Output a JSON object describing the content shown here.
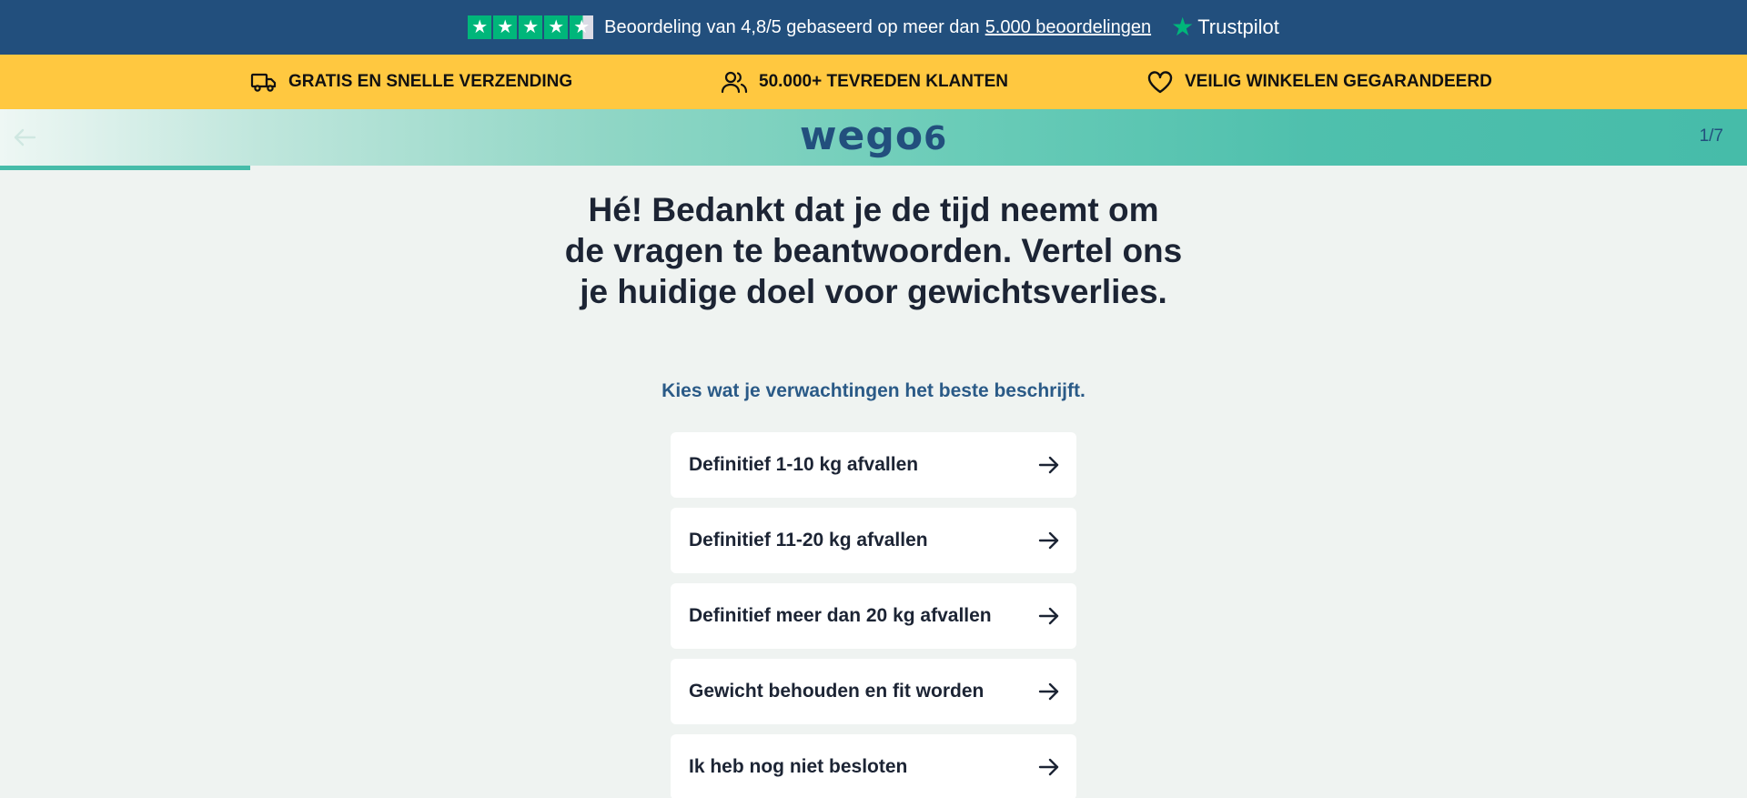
{
  "trustbar": {
    "rating_text": "Beoordeling van 4,8/5 gebaseerd op meer dan",
    "reviews_link": "5.000 beoordelingen",
    "brand": "Trustpilot",
    "stars": 4.5,
    "colors": {
      "star_green": "#00b67a",
      "bar_bg": "#224f7d"
    }
  },
  "usps": [
    {
      "icon": "truck-icon",
      "label": "GRATIS EN SNELLE VERZENDING"
    },
    {
      "icon": "users-icon",
      "label": "50.000+ TEVREDEN KLANTEN"
    },
    {
      "icon": "heart-icon",
      "label": "VEILIG WINKELEN GEGARANDEERD"
    }
  ],
  "header": {
    "logo_text": "wego",
    "logo_suffix": "6",
    "step": "1/7",
    "progress": 0.143
  },
  "question": {
    "title": "Hé! Bedankt dat je de tijd neemt om de vragen te beantwoorden. Vertel ons je huidige doel voor gewichtsverlies.",
    "subtitle": "Kies wat je verwachtingen het beste beschrijft.",
    "options": [
      {
        "label": "Definitief 1-10 kg afvallen"
      },
      {
        "label": "Definitief 11-20 kg afvallen"
      },
      {
        "label": "Definitief meer dan 20 kg afvallen"
      },
      {
        "label": "Gewicht behouden en fit worden"
      },
      {
        "label": "Ik heb nog niet besloten"
      }
    ]
  },
  "colors": {
    "accent": "#46bca9",
    "brand_blue": "#224f7d",
    "usp_bg": "#ffc840",
    "page_bg": "#eff3f1"
  }
}
